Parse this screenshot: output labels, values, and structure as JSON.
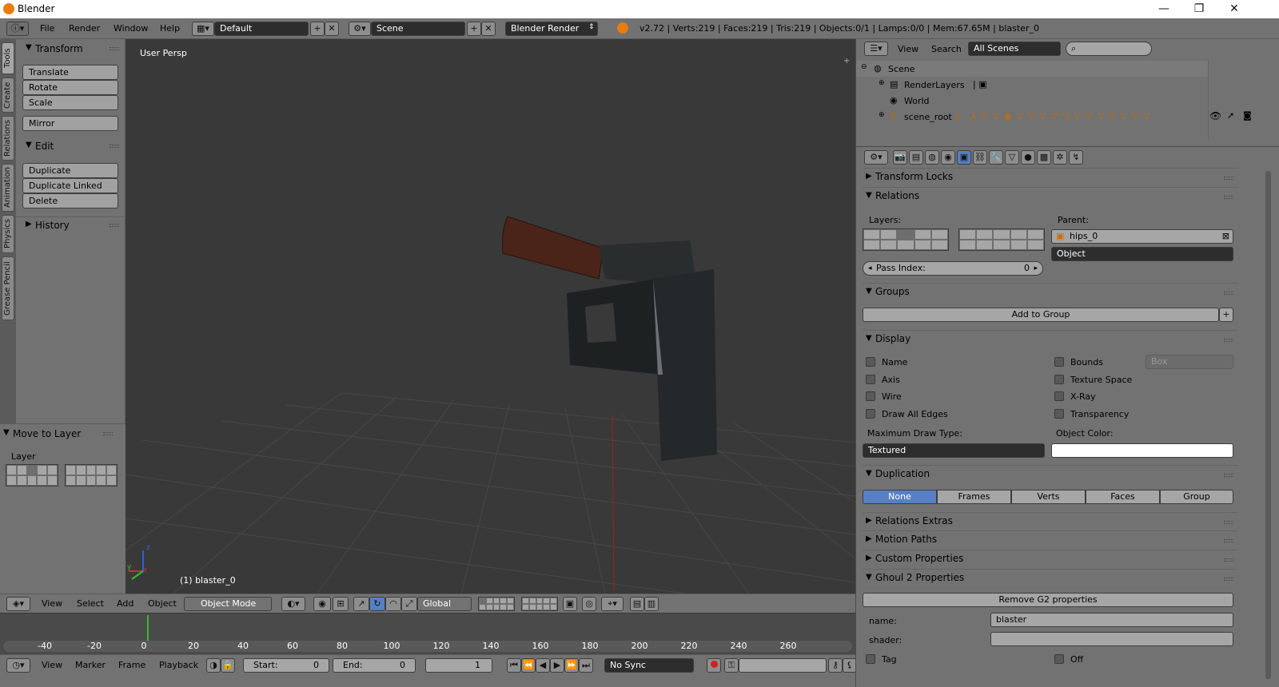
{
  "window": {
    "title": "Blender",
    "minimize": "—",
    "restore": "❐",
    "close": "✕"
  },
  "info": {
    "menus": [
      "File",
      "Render",
      "Window",
      "Help"
    ],
    "layout": "Default",
    "scene": "Scene",
    "engine": "Blender Render",
    "stats": "v2.72 | Verts:219 | Faces:219 | Tris:219 | Objects:0/1 | Lamps:0/0 | Mem:67.65M | blaster_0"
  },
  "toolshelf": {
    "tabs": [
      "Tools",
      "Create",
      "Relations",
      "Animation",
      "Physics",
      "Grease Pencil"
    ],
    "transform": {
      "title": "Transform",
      "buttons": [
        "Translate",
        "Rotate",
        "Scale"
      ],
      "mirror": "Mirror"
    },
    "edit": {
      "title": "Edit",
      "buttons": [
        "Duplicate",
        "Duplicate Linked",
        "Delete"
      ]
    },
    "history": {
      "title": "History"
    },
    "move_to_layer": {
      "title": "Move to Layer",
      "layer_label": "Layer"
    }
  },
  "viewport": {
    "view_name": "User Persp",
    "object_label": "(1) blaster_0",
    "axis_x": "x",
    "axis_y": "y",
    "axis_z": "z"
  },
  "view3d_header": {
    "menus": [
      "View",
      "Select",
      "Add",
      "Object"
    ],
    "mode": "Object Mode",
    "orientation": "Global"
  },
  "timeline": {
    "ticks": [
      "-40",
      "-20",
      "0",
      "20",
      "40",
      "60",
      "80",
      "100",
      "120",
      "140",
      "160",
      "180",
      "200",
      "220",
      "240",
      "260"
    ],
    "menus": [
      "View",
      "Marker",
      "Frame",
      "Playback"
    ],
    "start_label": "Start:",
    "start_value": "0",
    "end_label": "End:",
    "end_value": "0",
    "current_frame": "1",
    "sync": "No Sync"
  },
  "outliner": {
    "menus": [
      "View",
      "Search"
    ],
    "filter": "All Scenes",
    "rows": [
      "Scene",
      "RenderLayers",
      "World",
      "scene_root"
    ]
  },
  "properties": {
    "transform_locks": "Transform Locks",
    "relations": {
      "title": "Relations",
      "layers_label": "Layers:",
      "parent_label": "Parent:",
      "parent_value": "hips_0",
      "parent_type": "Object",
      "pass_index_label": "Pass Index:",
      "pass_index_value": "0"
    },
    "groups": {
      "title": "Groups",
      "add_button": "Add to Group"
    },
    "display": {
      "title": "Display",
      "left": [
        "Name",
        "Axis",
        "Wire",
        "Draw All Edges"
      ],
      "right": [
        "Bounds",
        "Texture Space",
        "X-Ray",
        "Transparency"
      ],
      "bounds_type": "Box",
      "max_draw_label": "Maximum Draw Type:",
      "max_draw_value": "Textured",
      "object_color_label": "Object Color:",
      "object_color": "#ffffff"
    },
    "duplication": {
      "title": "Duplication",
      "options": [
        "None",
        "Frames",
        "Verts",
        "Faces",
        "Group"
      ],
      "selected": "None"
    },
    "collapsed": [
      "Relations Extras",
      "Motion Paths",
      "Custom Properties"
    ],
    "ghoul2": {
      "title": "Ghoul 2 Properties",
      "remove_button": "Remove G2 properties",
      "name_label": "name:",
      "name_value": "blaster",
      "shader_label": "shader:",
      "shader_value": "",
      "tag_label": "Tag",
      "off_label": "Off"
    }
  },
  "colors": {
    "accent": "#5680c2",
    "panel": "#727272",
    "viewport": "#393939",
    "timeline_cursor": "#2fbf2f"
  }
}
